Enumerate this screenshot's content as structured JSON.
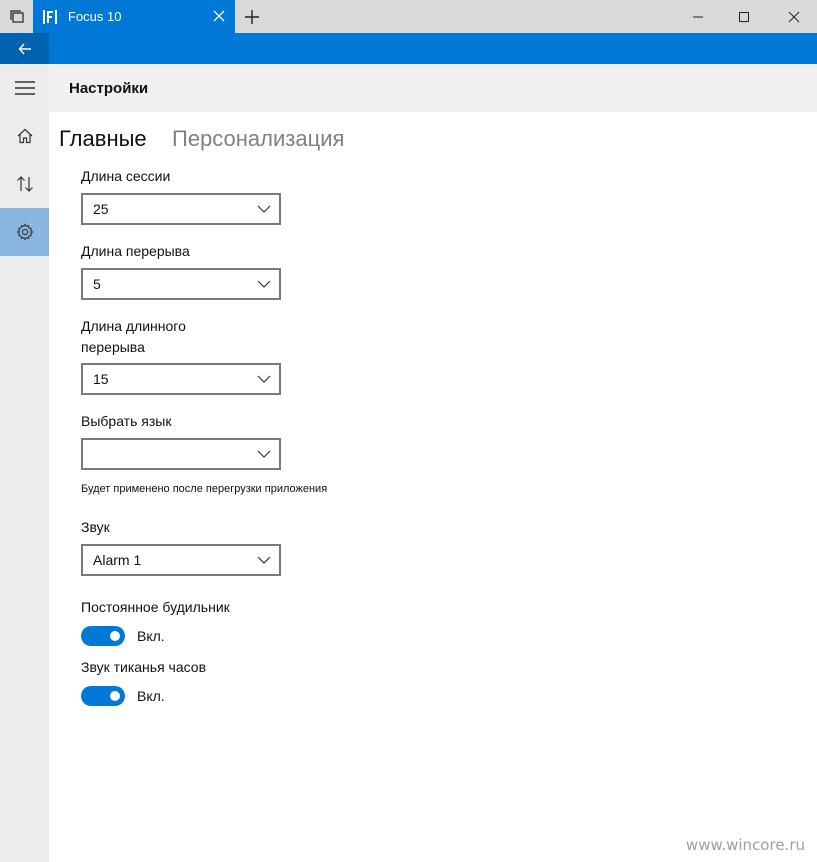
{
  "window": {
    "app_title": "Focus 10"
  },
  "header": {
    "title": "Настройки"
  },
  "pivots": [
    {
      "label": "Главные",
      "active": true
    },
    {
      "label": "Персонализация",
      "active": false
    }
  ],
  "settings": {
    "session_length": {
      "label": "Длина сессии",
      "value": "25"
    },
    "break_length": {
      "label": "Длина перерыва",
      "value": "5"
    },
    "long_break_length": {
      "label": "Длина длинного перерыва",
      "value": "15"
    },
    "language": {
      "label": "Выбрать язык",
      "value": "",
      "hint": "Будет применено после перегрузки приложения"
    },
    "sound": {
      "label": "Звук",
      "value": "Alarm 1"
    },
    "persistent_alarm": {
      "label": "Постоянное будильник",
      "state": "Вкл.",
      "on": true
    },
    "ticking_sound": {
      "label": "Звук тиканья часов",
      "state": "Вкл.",
      "on": true
    }
  },
  "nav": [
    {
      "icon": "home-icon"
    },
    {
      "icon": "sort-arrows-icon"
    },
    {
      "icon": "gear-icon",
      "selected": true
    }
  ],
  "watermark": "www.wincore.ru",
  "colors": {
    "accent": "#0078d7",
    "accent_dark": "#0063b1",
    "nav_selected": "#8ab6e0"
  }
}
